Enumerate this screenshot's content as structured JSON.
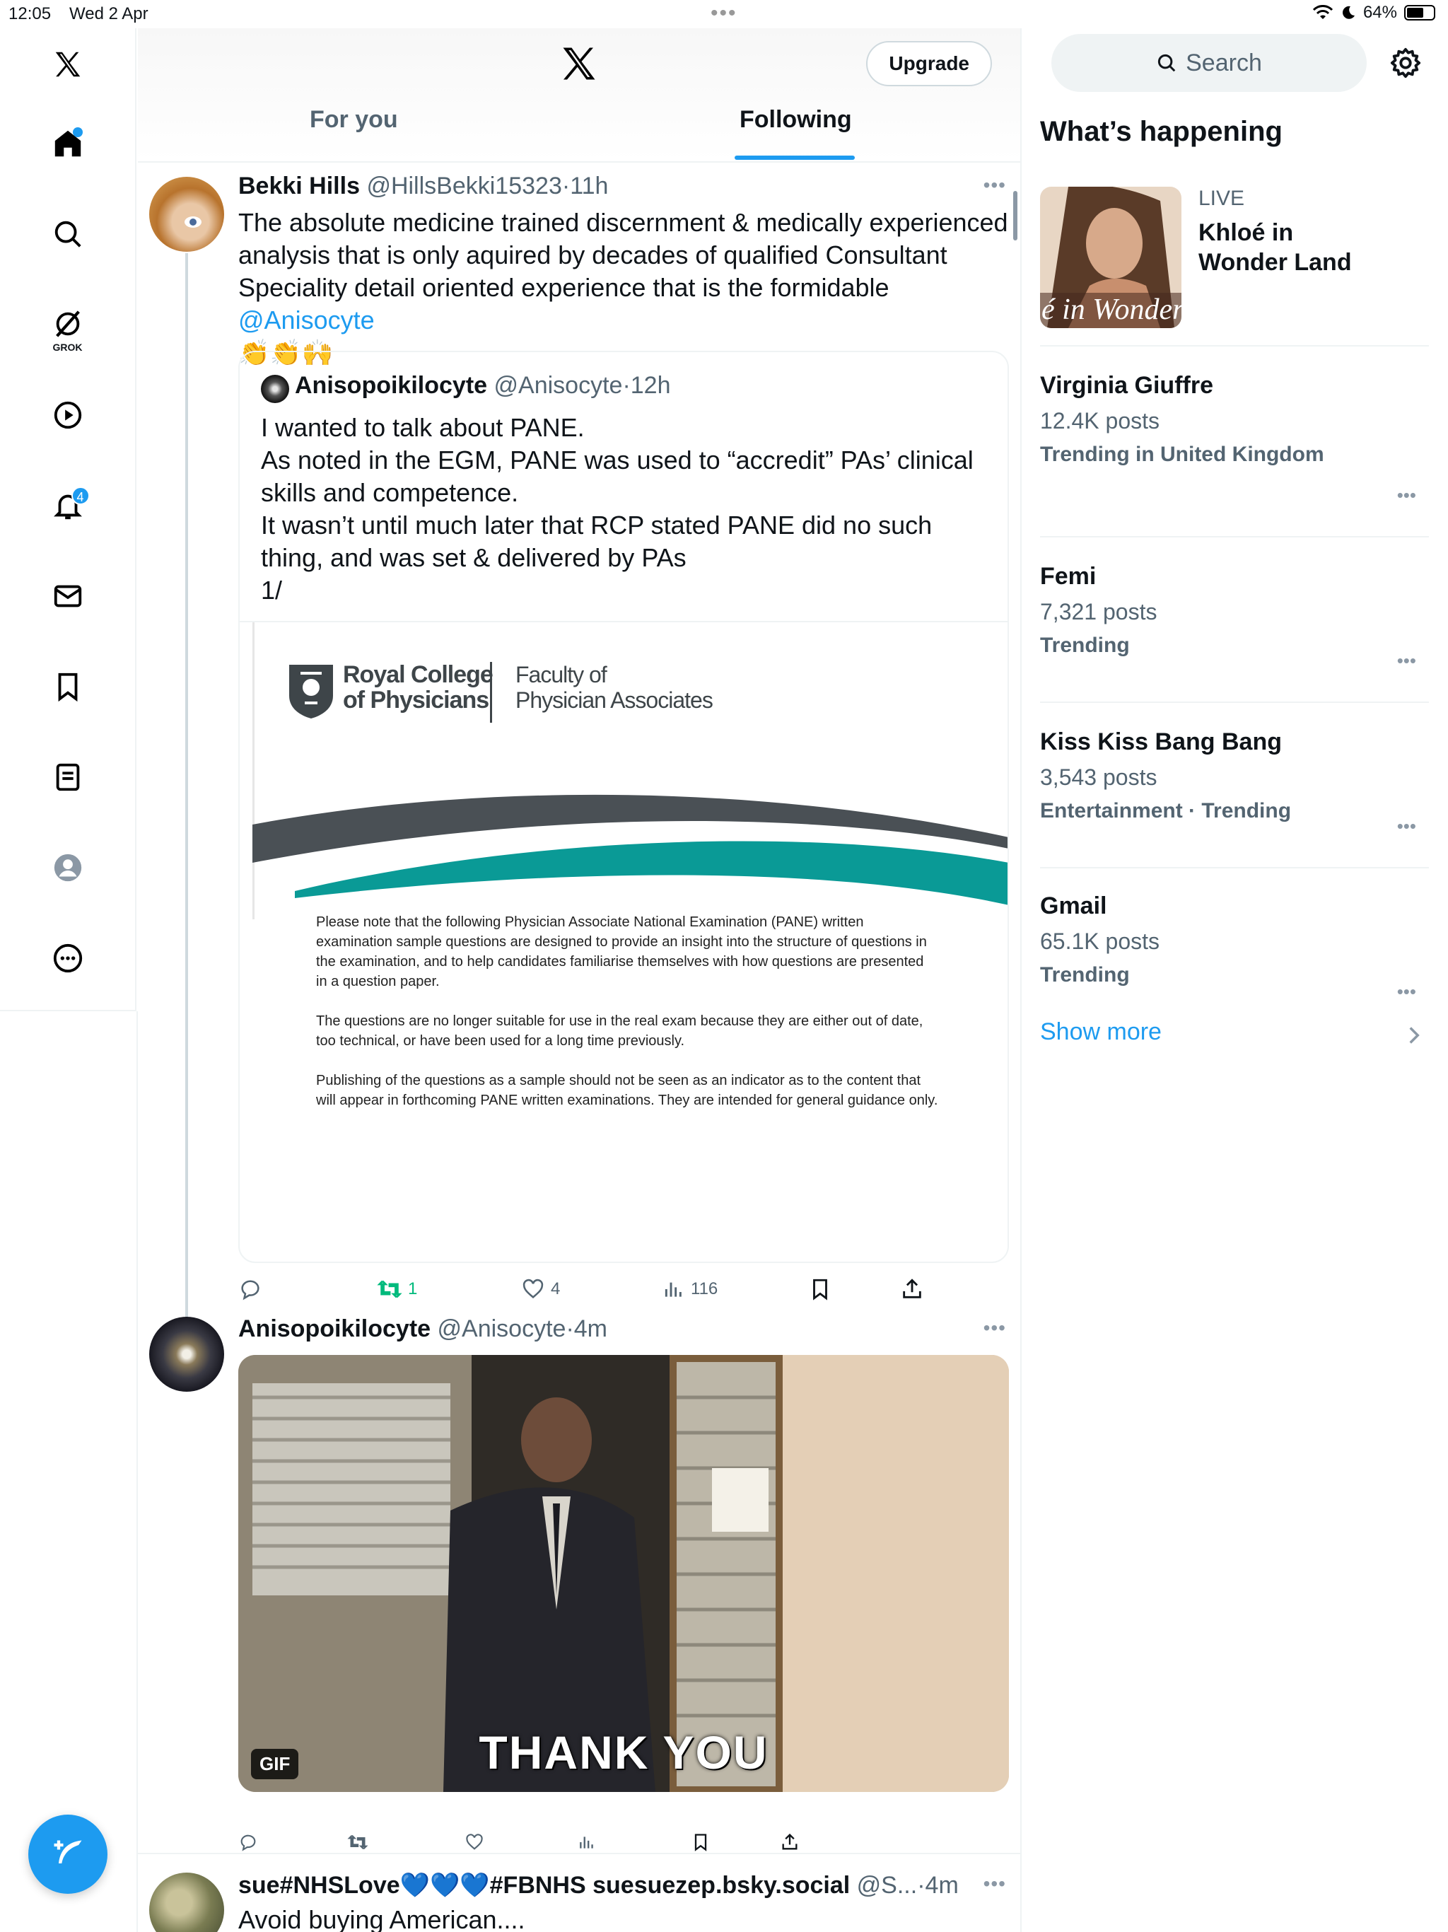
{
  "status_bar": {
    "time": "12:05",
    "date": "Wed 2 Apr",
    "battery": "64%",
    "battery_level": 0.64
  },
  "nav": {
    "grok_label": "GROK",
    "notifications_badge": "4"
  },
  "header": {
    "upgrade_label": "Upgrade"
  },
  "tabs": [
    {
      "label": "For you"
    },
    {
      "label": "Following"
    }
  ],
  "post1": {
    "name": "Bekki Hills",
    "handle": "@HillsBekki15323",
    "time": "11h",
    "text_before_mention": "The absolute medicine trained discernment & medically experienced analysis that is only aquired by decades of qualified Consultant Speciality detail oriented experience that is the formidable",
    "mention": "@Anisocyte",
    "emoji": "👏👏🙌",
    "quote": {
      "name": "Anisopoikilocyte",
      "handle": "@Anisocyte",
      "time": "12h",
      "lines": [
        "I wanted to talk about PANE.",
        "As noted in the EGM, PANE was used to “accredit” PAs’ clinical skills and competence.",
        "It wasn’t until much later that RCP stated PANE did no such thing, and was set & delivered by PAs",
        "1/"
      ],
      "doc": {
        "org_line1": "Royal College",
        "org_line2": "of Physicians",
        "faculty_line1": "Faculty of",
        "faculty_line2": "Physician Associates",
        "para1": "Please note that the following Physician Associate National Examination (PANE) written examination sample questions are designed to provide an insight into the structure of questions in the examination, and to help candidates familiarise themselves with how questions are presented in a question paper.",
        "para2": "The questions are no longer suitable for use in the real exam because they are either out of date, too technical, or have been used for a long time previously.",
        "para3": "Publishing of the questions as a sample should not be seen as an indicator as to the content that will appear in forthcoming PANE written examinations. They are intended for general guidance only."
      }
    },
    "retweets": "1",
    "likes": "4",
    "views": "116"
  },
  "post2": {
    "name": "Anisopoikilocyte",
    "handle": "@Anisocyte",
    "time": "4m",
    "gif_badge": "GIF",
    "gif_caption": "THANK YOU"
  },
  "post3": {
    "name": "sue#NHSLove💙💙💙#FBNHS suesuezep.bsky.social",
    "handle": "@S...",
    "time": "4m",
    "text": "Avoid buying American...."
  },
  "sidebar": {
    "search_placeholder": "Search",
    "title": "What’s happening",
    "live": {
      "badge": "LIVE",
      "title": "Khloé in Wonder Land",
      "thumb_text": "é in Wonder l"
    },
    "trends": [
      {
        "name": "Virginia Giuffre",
        "posts": "12.4K posts",
        "category": "Trending in United Kingdom"
      },
      {
        "name": "Femi",
        "posts": "7,321 posts",
        "category": "Trending"
      },
      {
        "name": "Kiss Kiss Bang Bang",
        "posts": "3,543 posts",
        "category": "Entertainment · Trending"
      },
      {
        "name": "Gmail",
        "posts": "65.1K posts",
        "category": "Trending"
      }
    ],
    "show_more": "Show more"
  },
  "colors": {
    "accent": "#1d9bf0",
    "retweet_active": "#00ba7c",
    "text_secondary": "#536471",
    "teal_swoosh": "#0a9a96",
    "grey_swoosh": "#4a5055"
  }
}
